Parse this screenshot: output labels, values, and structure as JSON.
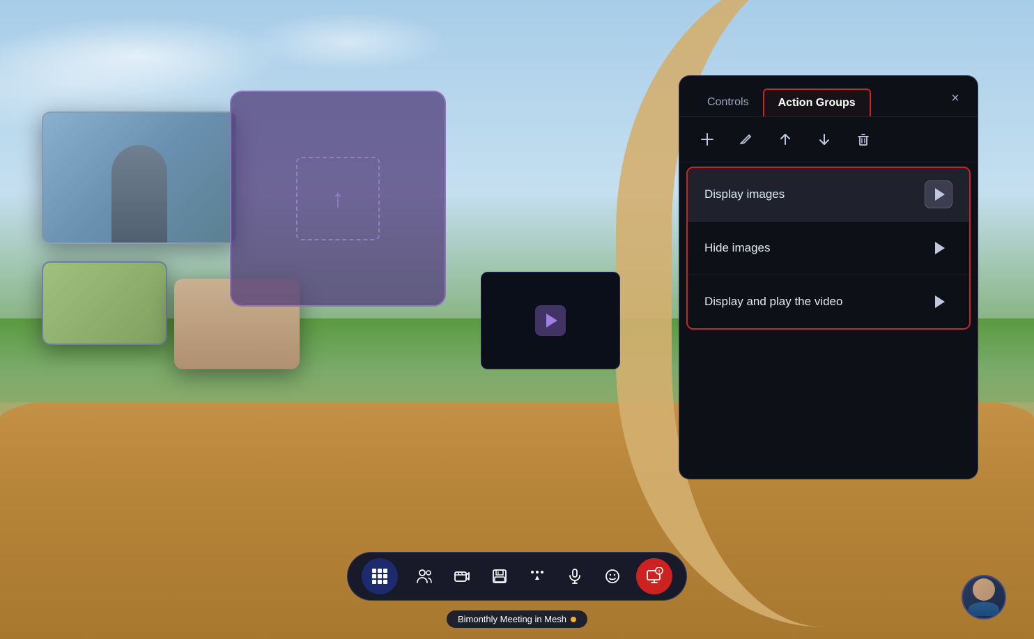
{
  "scene": {
    "meeting_label": "Bimonthly Meeting in Mesh",
    "meeting_dot_color": "#f0b030"
  },
  "panel": {
    "tabs": [
      {
        "id": "controls",
        "label": "Controls",
        "active": false
      },
      {
        "id": "action-groups",
        "label": "Action Groups",
        "active": true
      }
    ],
    "close_label": "×",
    "toolbar_icons": [
      "add",
      "edit",
      "move-up",
      "move-down",
      "delete"
    ],
    "action_items": [
      {
        "id": "display-images",
        "label": "Display images",
        "active": true
      },
      {
        "id": "hide-images",
        "label": "Hide images",
        "active": false
      },
      {
        "id": "display-play-video",
        "label": "Display and play the video",
        "active": false
      }
    ]
  },
  "toolbar": {
    "buttons": [
      {
        "id": "grid",
        "icon": "⊞",
        "label": "Grid"
      },
      {
        "id": "people",
        "icon": "👥",
        "label": "People"
      },
      {
        "id": "record",
        "icon": "🎬",
        "label": "Record"
      },
      {
        "id": "save",
        "icon": "💾",
        "label": "Save"
      },
      {
        "id": "more",
        "icon": "•••",
        "label": "More"
      },
      {
        "id": "mic",
        "icon": "🎤",
        "label": "Microphone"
      },
      {
        "id": "react",
        "icon": "🙂",
        "label": "Reactions"
      },
      {
        "id": "share",
        "icon": "📤",
        "label": "Share"
      }
    ]
  },
  "upload_panel": {
    "arrow": "↑"
  }
}
